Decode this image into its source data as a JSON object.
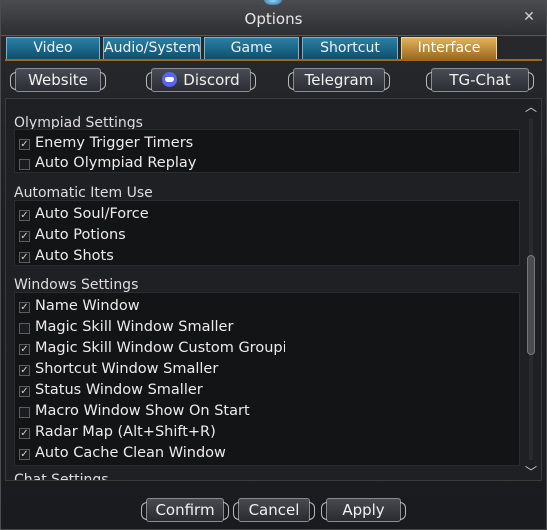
{
  "window": {
    "title": "Options",
    "close_glyph": "✕"
  },
  "tabs": [
    {
      "label": "Video",
      "active": false
    },
    {
      "label": "Audio/System",
      "active": false
    },
    {
      "label": "Game",
      "active": false
    },
    {
      "label": "Shortcut",
      "active": false
    },
    {
      "label": "Interface",
      "active": true
    }
  ],
  "links": [
    {
      "label": "Website"
    },
    {
      "label": "Discord",
      "icon": "discord-icon"
    },
    {
      "label": "Telegram"
    },
    {
      "label": "TG-Chat"
    }
  ],
  "sections": [
    {
      "title": "Olympiad Settings",
      "options": [
        {
          "label": "Enemy Trigger Timers",
          "checked": true
        },
        {
          "label": "Auto Olympiad Replay",
          "checked": false
        }
      ]
    },
    {
      "title": "Automatic Item Use",
      "options": [
        {
          "label": "Auto Soul/Force",
          "checked": true
        },
        {
          "label": "Auto Potions",
          "checked": true
        },
        {
          "label": "Auto Shots",
          "checked": true
        }
      ]
    },
    {
      "title": "Windows Settings",
      "options": [
        {
          "label": "Name Window",
          "checked": true
        },
        {
          "label": "Magic Skill Window Smaller",
          "checked": false
        },
        {
          "label": "Magic Skill Window Custom Grouping",
          "checked": true
        },
        {
          "label": "Shortcut Window Smaller",
          "checked": true
        },
        {
          "label": "Status Window Smaller",
          "checked": true
        },
        {
          "label": "Macro Window Show On Start",
          "checked": false
        },
        {
          "label": "Radar Map (Alt+Shift+R)",
          "checked": true
        },
        {
          "label": "Auto Cache Clean Window",
          "checked": true
        }
      ]
    },
    {
      "title": "Chat Settings",
      "options": []
    }
  ],
  "footer": {
    "confirm": "Confirm",
    "cancel": "Cancel",
    "apply": "Apply"
  },
  "colors": {
    "active_tab": "#c8953f",
    "inactive_tab": "#1a6a8e",
    "background": "#1d1e21"
  }
}
